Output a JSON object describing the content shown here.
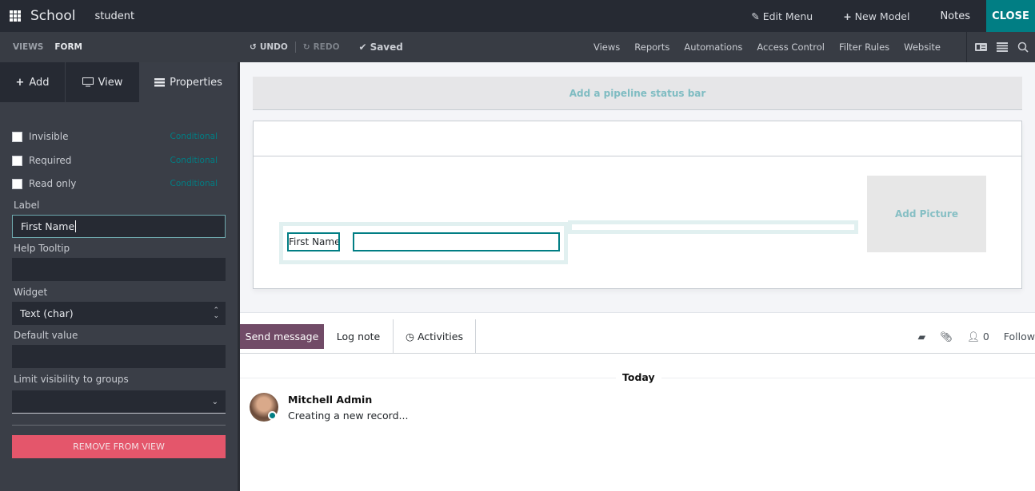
{
  "topbar": {
    "app_name": "School",
    "model_name": "student",
    "edit_menu": "Edit Menu",
    "new_model": "New Model",
    "notes": "Notes",
    "close": "CLOSE"
  },
  "subbar": {
    "breadcrumb": [
      "VIEWS",
      "FORM"
    ],
    "undo": "UNDO",
    "redo": "REDO",
    "saved": "Saved",
    "nav": [
      "Views",
      "Reports",
      "Automations",
      "Access Control",
      "Filter Rules",
      "Website"
    ]
  },
  "sidebar": {
    "tabs": {
      "add": "Add",
      "view": "View",
      "properties": "Properties"
    },
    "checkboxes": [
      {
        "label": "Invisible",
        "checked": false,
        "link": "Conditional"
      },
      {
        "label": "Required",
        "checked": false,
        "link": "Conditional"
      },
      {
        "label": "Read only",
        "checked": false,
        "link": "Conditional"
      }
    ],
    "label_field": {
      "label": "Label",
      "value": "First Name"
    },
    "help_tooltip": {
      "label": "Help Tooltip",
      "value": ""
    },
    "widget": {
      "label": "Widget",
      "value": "Text (char)"
    },
    "default_value": {
      "label": "Default value",
      "value": ""
    },
    "groups": {
      "label": "Limit visibility to groups",
      "value": ""
    },
    "remove_button": "REMOVE FROM VIEW"
  },
  "form": {
    "pipeline_placeholder": "Add a pipeline status bar",
    "add_picture": "Add Picture",
    "field_label": "First Name"
  },
  "chatter": {
    "send_message": "Send message",
    "log_note": "Log note",
    "activities": "Activities",
    "followers_count": "0",
    "follow": "Follow",
    "date_separator": "Today",
    "message": {
      "author": "Mitchell Admin",
      "body": "Creating a new record..."
    }
  },
  "colors": {
    "brand_teal": "#017e84",
    "send_button": "#714b67",
    "remove_button": "#e4566b"
  }
}
